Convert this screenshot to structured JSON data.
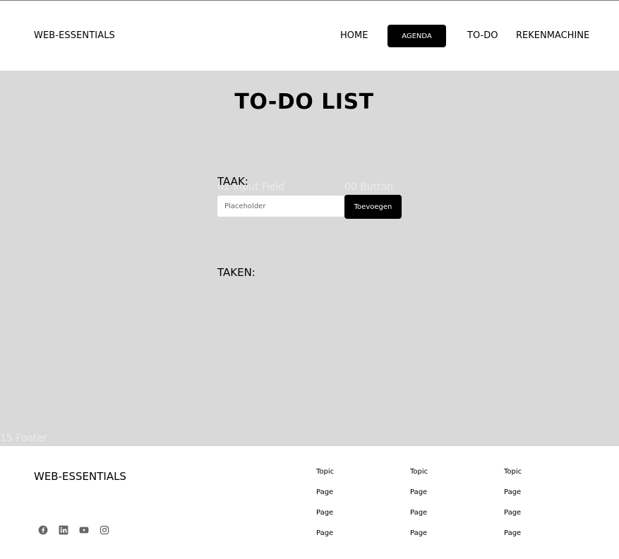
{
  "header": {
    "logo": "WEB-ESSENTIALS",
    "nav": {
      "home": "HOME",
      "agenda": "AGENDA",
      "todo": "TO-DO",
      "calculator": "REKENMACHINE"
    }
  },
  "main": {
    "title": "TO-DO LIST",
    "ghost_labels": {
      "input": "01 Input Field",
      "button": "00 Button",
      "footer": "15 Footer"
    },
    "task_label": "TAAK:",
    "task_input_placeholder": "Placeholder",
    "add_button": "Toevoegen",
    "tasks_label": "TAKEN:"
  },
  "footer": {
    "logo": "WEB-ESSENTIALS",
    "social_icons": [
      "facebook-icon",
      "linkedin-icon",
      "youtube-icon",
      "instagram-icon"
    ],
    "columns": [
      {
        "topic": "Topic",
        "pages": [
          "Page",
          "Page",
          "Page"
        ]
      },
      {
        "topic": "Topic",
        "pages": [
          "Page",
          "Page",
          "Page"
        ]
      },
      {
        "topic": "Topic",
        "pages": [
          "Page",
          "Page",
          "Page"
        ]
      }
    ]
  },
  "colors": {
    "main_background": "#d9d9d9",
    "accent": "#000000",
    "icon": "#666666"
  }
}
